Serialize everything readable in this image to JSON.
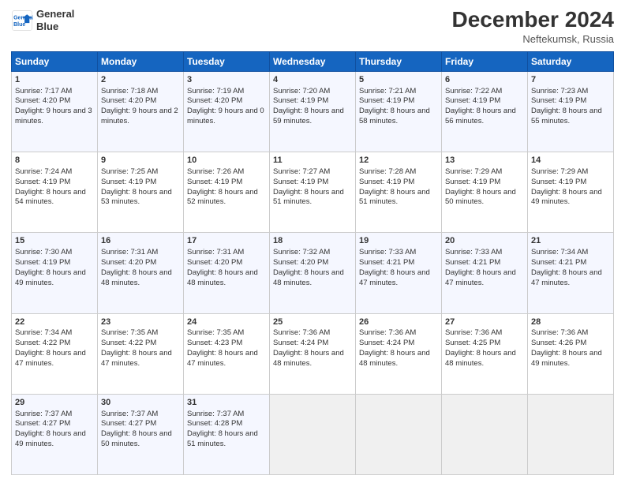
{
  "header": {
    "logo_line1": "General",
    "logo_line2": "Blue",
    "title": "December 2024",
    "subtitle": "Neftekumsk, Russia"
  },
  "weekdays": [
    "Sunday",
    "Monday",
    "Tuesday",
    "Wednesday",
    "Thursday",
    "Friday",
    "Saturday"
  ],
  "weeks": [
    [
      {
        "day": "1",
        "sunrise": "Sunrise: 7:17 AM",
        "sunset": "Sunset: 4:20 PM",
        "daylight": "Daylight: 9 hours and 3 minutes."
      },
      {
        "day": "2",
        "sunrise": "Sunrise: 7:18 AM",
        "sunset": "Sunset: 4:20 PM",
        "daylight": "Daylight: 9 hours and 2 minutes."
      },
      {
        "day": "3",
        "sunrise": "Sunrise: 7:19 AM",
        "sunset": "Sunset: 4:20 PM",
        "daylight": "Daylight: 9 hours and 0 minutes."
      },
      {
        "day": "4",
        "sunrise": "Sunrise: 7:20 AM",
        "sunset": "Sunset: 4:19 PM",
        "daylight": "Daylight: 8 hours and 59 minutes."
      },
      {
        "day": "5",
        "sunrise": "Sunrise: 7:21 AM",
        "sunset": "Sunset: 4:19 PM",
        "daylight": "Daylight: 8 hours and 58 minutes."
      },
      {
        "day": "6",
        "sunrise": "Sunrise: 7:22 AM",
        "sunset": "Sunset: 4:19 PM",
        "daylight": "Daylight: 8 hours and 56 minutes."
      },
      {
        "day": "7",
        "sunrise": "Sunrise: 7:23 AM",
        "sunset": "Sunset: 4:19 PM",
        "daylight": "Daylight: 8 hours and 55 minutes."
      }
    ],
    [
      {
        "day": "8",
        "sunrise": "Sunrise: 7:24 AM",
        "sunset": "Sunset: 4:19 PM",
        "daylight": "Daylight: 8 hours and 54 minutes."
      },
      {
        "day": "9",
        "sunrise": "Sunrise: 7:25 AM",
        "sunset": "Sunset: 4:19 PM",
        "daylight": "Daylight: 8 hours and 53 minutes."
      },
      {
        "day": "10",
        "sunrise": "Sunrise: 7:26 AM",
        "sunset": "Sunset: 4:19 PM",
        "daylight": "Daylight: 8 hours and 52 minutes."
      },
      {
        "day": "11",
        "sunrise": "Sunrise: 7:27 AM",
        "sunset": "Sunset: 4:19 PM",
        "daylight": "Daylight: 8 hours and 51 minutes."
      },
      {
        "day": "12",
        "sunrise": "Sunrise: 7:28 AM",
        "sunset": "Sunset: 4:19 PM",
        "daylight": "Daylight: 8 hours and 51 minutes."
      },
      {
        "day": "13",
        "sunrise": "Sunrise: 7:29 AM",
        "sunset": "Sunset: 4:19 PM",
        "daylight": "Daylight: 8 hours and 50 minutes."
      },
      {
        "day": "14",
        "sunrise": "Sunrise: 7:29 AM",
        "sunset": "Sunset: 4:19 PM",
        "daylight": "Daylight: 8 hours and 49 minutes."
      }
    ],
    [
      {
        "day": "15",
        "sunrise": "Sunrise: 7:30 AM",
        "sunset": "Sunset: 4:19 PM",
        "daylight": "Daylight: 8 hours and 49 minutes."
      },
      {
        "day": "16",
        "sunrise": "Sunrise: 7:31 AM",
        "sunset": "Sunset: 4:20 PM",
        "daylight": "Daylight: 8 hours and 48 minutes."
      },
      {
        "day": "17",
        "sunrise": "Sunrise: 7:31 AM",
        "sunset": "Sunset: 4:20 PM",
        "daylight": "Daylight: 8 hours and 48 minutes."
      },
      {
        "day": "18",
        "sunrise": "Sunrise: 7:32 AM",
        "sunset": "Sunset: 4:20 PM",
        "daylight": "Daylight: 8 hours and 48 minutes."
      },
      {
        "day": "19",
        "sunrise": "Sunrise: 7:33 AM",
        "sunset": "Sunset: 4:21 PM",
        "daylight": "Daylight: 8 hours and 47 minutes."
      },
      {
        "day": "20",
        "sunrise": "Sunrise: 7:33 AM",
        "sunset": "Sunset: 4:21 PM",
        "daylight": "Daylight: 8 hours and 47 minutes."
      },
      {
        "day": "21",
        "sunrise": "Sunrise: 7:34 AM",
        "sunset": "Sunset: 4:21 PM",
        "daylight": "Daylight: 8 hours and 47 minutes."
      }
    ],
    [
      {
        "day": "22",
        "sunrise": "Sunrise: 7:34 AM",
        "sunset": "Sunset: 4:22 PM",
        "daylight": "Daylight: 8 hours and 47 minutes."
      },
      {
        "day": "23",
        "sunrise": "Sunrise: 7:35 AM",
        "sunset": "Sunset: 4:22 PM",
        "daylight": "Daylight: 8 hours and 47 minutes."
      },
      {
        "day": "24",
        "sunrise": "Sunrise: 7:35 AM",
        "sunset": "Sunset: 4:23 PM",
        "daylight": "Daylight: 8 hours and 47 minutes."
      },
      {
        "day": "25",
        "sunrise": "Sunrise: 7:36 AM",
        "sunset": "Sunset: 4:24 PM",
        "daylight": "Daylight: 8 hours and 48 minutes."
      },
      {
        "day": "26",
        "sunrise": "Sunrise: 7:36 AM",
        "sunset": "Sunset: 4:24 PM",
        "daylight": "Daylight: 8 hours and 48 minutes."
      },
      {
        "day": "27",
        "sunrise": "Sunrise: 7:36 AM",
        "sunset": "Sunset: 4:25 PM",
        "daylight": "Daylight: 8 hours and 48 minutes."
      },
      {
        "day": "28",
        "sunrise": "Sunrise: 7:36 AM",
        "sunset": "Sunset: 4:26 PM",
        "daylight": "Daylight: 8 hours and 49 minutes."
      }
    ],
    [
      {
        "day": "29",
        "sunrise": "Sunrise: 7:37 AM",
        "sunset": "Sunset: 4:27 PM",
        "daylight": "Daylight: 8 hours and 49 minutes."
      },
      {
        "day": "30",
        "sunrise": "Sunrise: 7:37 AM",
        "sunset": "Sunset: 4:27 PM",
        "daylight": "Daylight: 8 hours and 50 minutes."
      },
      {
        "day": "31",
        "sunrise": "Sunrise: 7:37 AM",
        "sunset": "Sunset: 4:28 PM",
        "daylight": "Daylight: 8 hours and 51 minutes."
      },
      null,
      null,
      null,
      null
    ]
  ]
}
